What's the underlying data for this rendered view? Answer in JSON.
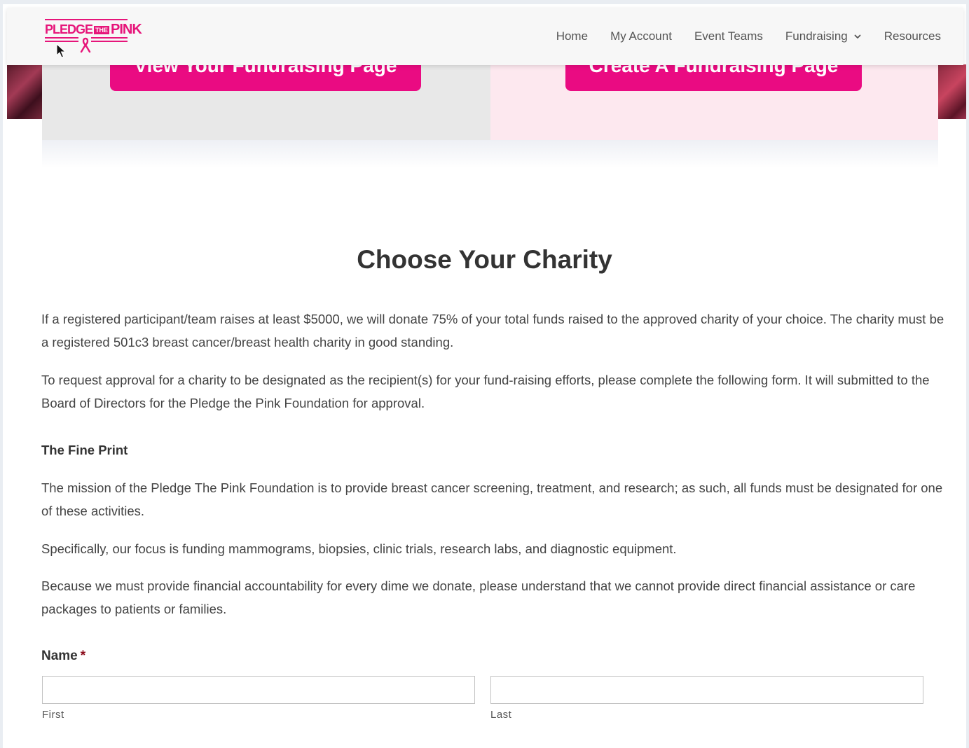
{
  "header": {
    "logo": {
      "word1": "PLEDGE",
      "word2": "THE",
      "word3": "PINK"
    },
    "nav": [
      {
        "label": "Home"
      },
      {
        "label": "My Account"
      },
      {
        "label": "Event Teams"
      },
      {
        "label": "Fundraising"
      },
      {
        "label": "Resources"
      }
    ]
  },
  "hero": {
    "view_button": "View Your Fundraising Page",
    "create_button": "Create A Fundraising Page"
  },
  "content": {
    "title": "Choose Your Charity",
    "p1": "If a registered participant/team raises at least $5000, we will donate 75% of your total funds raised to the approved charity of your choice. The charity must be a registered 501c3 breast cancer/breast health charity in good standing.",
    "p2": "To request approval for a charity to be designated as the recipient(s) for your fund-raising efforts, please complete the following form. It will submitted to the Board of Directors for the Pledge the Pink Foundation for approval.",
    "fine_print_heading": "The Fine Print",
    "p3": "The mission of the Pledge The Pink Foundation is to provide breast cancer screening, treatment, and research; as such, all funds must be designated for one of these activities.",
    "p4": "Specifically, our focus is funding mammograms, biopsies, clinic trials, research labs, and diagnostic equipment.",
    "p5": "Because we must provide financial accountability for every dime we donate, please understand that we cannot provide direct financial assistance or care packages to patients or families."
  },
  "form": {
    "name_label": "Name",
    "required_mark": "*",
    "first_value": "",
    "last_value": "",
    "first_sublabel": "First",
    "last_sublabel": "Last"
  },
  "colors": {
    "brand_pink": "#ea0b82",
    "required_red": "#8b0a1a"
  }
}
